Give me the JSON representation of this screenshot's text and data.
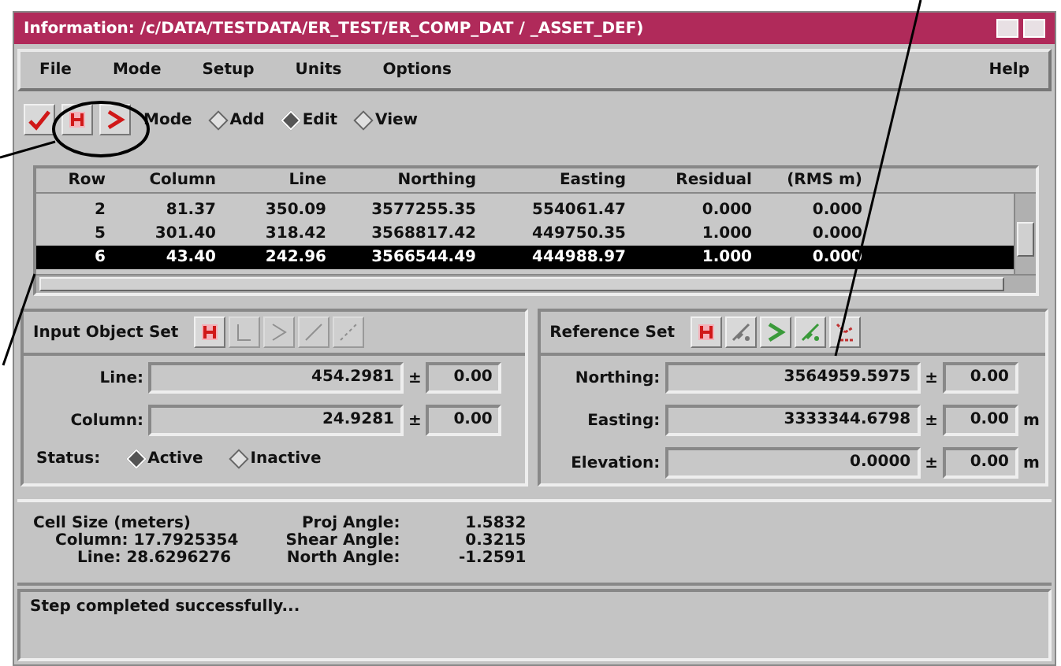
{
  "window": {
    "title": "Information: /c/DATA/TESTDATA/ER_TEST/ER_COMP_DAT / _ASSET_DEF)"
  },
  "menu": [
    {
      "label": "File"
    },
    {
      "label": "Mode"
    },
    {
      "label": "Setup"
    },
    {
      "label": "Units"
    },
    {
      "label": "Options"
    },
    {
      "label": "Help"
    }
  ],
  "toolbar": {
    "mode_label": "Mode",
    "modes": [
      {
        "label": "Add",
        "selected": false
      },
      {
        "label": "Edit",
        "selected": true
      },
      {
        "label": "View",
        "selected": false
      }
    ]
  },
  "table": {
    "columns": [
      "Row",
      "Column",
      "Line",
      "Northing",
      "Easting",
      "Residual",
      "(RMS m)"
    ],
    "rows": [
      {
        "cells": [
          "2",
          "81.37",
          "350.09",
          "3577255.35",
          "554061.47",
          "0.000",
          "0.000"
        ],
        "selected": false
      },
      {
        "cells": [
          "5",
          "301.40",
          "318.42",
          "3568817.42",
          "449750.35",
          "1.000",
          "0.000"
        ],
        "selected": false
      },
      {
        "cells": [
          "6",
          "43.40",
          "242.96",
          "3566544.49",
          "444988.97",
          "1.000",
          "0.000"
        ],
        "selected": true
      }
    ]
  },
  "input_panel": {
    "title": "Input Object Set",
    "fields": [
      {
        "label": "Line:",
        "value": "454.2981",
        "sign": "±",
        "error": "0.00"
      },
      {
        "label": "Column:",
        "value": "24.9281",
        "sign": "±",
        "error": "0.00"
      }
    ],
    "status": {
      "label": "Status:",
      "options": [
        {
          "label": "Active",
          "selected": true
        },
        {
          "label": "Inactive",
          "selected": false
        }
      ]
    }
  },
  "reference_panel": {
    "title": "Reference Set",
    "fields": [
      {
        "label": "Northing:",
        "value": "3564959.5975",
        "sign": "±",
        "error": "0.00"
      },
      {
        "label": "Easting:",
        "value": "3333344.6798",
        "sign": "±",
        "error": "0.00",
        "unit": "m"
      },
      {
        "label": "Elevation:",
        "value": "0.0000",
        "sign": "±",
        "error": "0.00",
        "unit": "m"
      }
    ]
  },
  "info": {
    "cell_size": "Cell Size (meters)",
    "column_label": "Column:",
    "column_value": "17.7925354",
    "line_label": "Line:",
    "line_value": "28.6296276",
    "angles": [
      {
        "label": "Proj Angle:",
        "value": "1.5832"
      },
      {
        "label": "Shear Angle:",
        "value": "0.3215"
      },
      {
        "label": "North Angle:",
        "value": "-1.2591"
      }
    ]
  },
  "status_bar": "Step completed successfully..."
}
